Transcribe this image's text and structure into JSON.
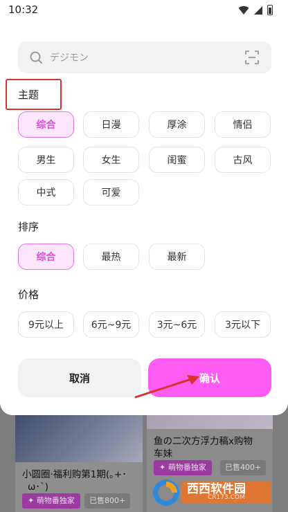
{
  "status_bar": {
    "time": "10:32"
  },
  "search": {
    "placeholder": "デジモン"
  },
  "sections": {
    "theme": {
      "title": "主题",
      "options": [
        "综合",
        "日漫",
        "厚涂",
        "情侣",
        "男生",
        "女生",
        "闺蜜",
        "古风",
        "中式",
        "可爱"
      ],
      "selected": "综合"
    },
    "sort": {
      "title": "排序",
      "options": [
        "综合",
        "最热",
        "最新"
      ],
      "selected": "综合"
    },
    "price": {
      "title": "价格",
      "options": [
        "9元以上",
        "6元~9元",
        "3元~6元",
        "3元以下"
      ]
    }
  },
  "actions": {
    "cancel": "取消",
    "confirm": "确认"
  },
  "background": {
    "card_left": {
      "title_line1": "小圆圈·福利购第1期(｡+･",
      "title_line2": "ω･`)",
      "tag": "✦ 萌物番独家",
      "sold": "已售800+"
    },
    "card_right": {
      "title_line1": "鱼の二次方浮力稿x购物",
      "title_line2": "车妹",
      "tag": "✦ 萌物番独家",
      "sold": "已售400+"
    }
  },
  "watermark": {
    "brand": "西西软件园",
    "url": "CR173.COM"
  },
  "colors": {
    "accent": "#ff5cf4",
    "chip_active_bg": "#fbe6fb",
    "annotation_red": "#d9342b"
  }
}
